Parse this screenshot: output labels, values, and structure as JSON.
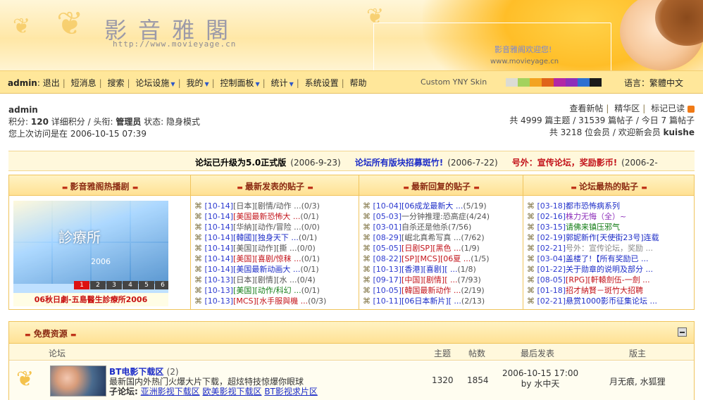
{
  "header": {
    "site_title": "影音雅閣",
    "site_url": "http://www.movieyage.cn",
    "welcome_text": "影音雅阁欢迎您!",
    "site_url_small": "www.movieyage.cn"
  },
  "nav": {
    "user": "admin",
    "items": [
      {
        "label": "退出",
        "dropdown": false
      },
      {
        "label": "短消息",
        "dropdown": false
      },
      {
        "label": "搜索",
        "dropdown": false
      },
      {
        "label": "论坛设施",
        "dropdown": true
      },
      {
        "label": "我的",
        "dropdown": true
      },
      {
        "label": "控制面板",
        "dropdown": true
      },
      {
        "label": "统计",
        "dropdown": true
      },
      {
        "label": "系统设置",
        "dropdown": false
      },
      {
        "label": "帮助",
        "dropdown": false
      }
    ],
    "skin_label": "Custom YNY Skin",
    "skin_colors": [
      "#dcdcd4",
      "#a4d25d",
      "#f3a321",
      "#e0641a",
      "#b327a6",
      "#8d2fba",
      "#2c70d1",
      "#1a1a1a"
    ],
    "language_label": "语言：繁體中文"
  },
  "user_info": {
    "username": "admin",
    "line1_label": "积分:",
    "points": "120",
    "line1_rest": "详细积分 / 头衔:",
    "rank": "管理员",
    "status_label": "状态:",
    "status": "隐身模式",
    "last_visit": "您上次访问是在 2006-10-15 07:39"
  },
  "stats": {
    "links": [
      "查看新帖",
      "精华区",
      "标记已读"
    ],
    "line2": "共 4999 篇主题 / 31539 篇帖子 / 今日 7 篇帖子",
    "line3_prefix": "共 3218 位会员 / 欢迎新会员",
    "newest_member": "kuishe"
  },
  "announcements": [
    {
      "title": "论坛已升级为5.0正式版",
      "date": "(2006-9-23)",
      "color": "#000000"
    },
    {
      "title": "论坛所有版块招募斑竹!",
      "date": "(2006-7-22)",
      "color": "#1c2cc7"
    },
    {
      "title": "号外：宣传论坛，奖励影币!",
      "date": "(2006-2-",
      "color": "#c3141b"
    }
  ],
  "board": {
    "columns": [
      "影音雅阁热播剧",
      "最新发表的贴子",
      "最新回复的贴子",
      "论坛最热的贴子"
    ],
    "promo": {
      "title": "診療所",
      "year": "2006",
      "nums": [
        "1",
        "2",
        "3",
        "4",
        "5",
        "6"
      ],
      "caption": "06秋日劇-五島醫生診療所2006"
    },
    "latest_posts": [
      {
        "date": "[10-14]",
        "title": "[日本][剧情/动作 ...",
        "count": "(0/3)"
      },
      {
        "date": "[10-14]",
        "title": "[美国最新恐怖大 ...",
        "count": "(0/1)"
      },
      {
        "date": "[10-14]",
        "title": "[华納][动作/冒险 ...",
        "count": "(0/0)"
      },
      {
        "date": "[10-14]",
        "title": "[韓國][独身天下 ...",
        "count": "(0/1)"
      },
      {
        "date": "[10-14]",
        "title": "[美国][动作][撕 ...",
        "count": "(0/0)"
      },
      {
        "date": "[10-14]",
        "title": "[美国][喜剧/惊秣 ...",
        "count": "(0/1)"
      },
      {
        "date": "[10-14]",
        "title": "[美国最新动画大 ...",
        "count": "(0/1)"
      },
      {
        "date": "[10-13]",
        "title": "[日本][剧情][水 ...",
        "count": "(0/4)"
      },
      {
        "date": "[10-13]",
        "title": "[美国][动作/科幻 ...",
        "count": "(0/1)"
      },
      {
        "date": "[10-13]",
        "title": "[MCS][水手服與機 ...",
        "count": "(0/3)"
      }
    ],
    "latest_posts_colors": [
      "#555555",
      "#c3141b",
      "#555555",
      "#1c2cc7",
      "#555555",
      "#c3141b",
      "#1c2cc7",
      "#555555",
      "#137d16",
      "#c3141b"
    ],
    "latest_replies": [
      {
        "date": "[10-04]",
        "title": "[06成龙最新大 ...",
        "count": "(5/19)"
      },
      {
        "date": "[05-03]",
        "title": "一分钟推理:恐高症",
        "count": "(4/24)"
      },
      {
        "date": "[03-01]",
        "title": "自杀还是他杀",
        "count": "(7/56)"
      },
      {
        "date": "[08-29]",
        "title": "[崛北真希写真 ...",
        "count": "(7/62)"
      },
      {
        "date": "[05-05]",
        "title": "[日剧SP][黑色 ...",
        "count": "(1/9)"
      },
      {
        "date": "[08-22]",
        "title": "[SP][MCS][06夏 ...",
        "count": "(1/5)"
      },
      {
        "date": "[10-13]",
        "title": "[香港][喜剧][ ...",
        "count": "(1/8)"
      },
      {
        "date": "[09-17]",
        "title": "[中国][剧情][ ...",
        "count": "(7/93)"
      },
      {
        "date": "[10-05]",
        "title": "[韓国最新动作 ...",
        "count": "(2/19)"
      },
      {
        "date": "[10-11]",
        "title": "[06日本新片][ ...",
        "count": "(2/13)"
      }
    ],
    "latest_replies_colors": [
      "#1c2cc7",
      "#555555",
      "#555555",
      "#555555",
      "#c3141b",
      "#c3141b",
      "#1c2cc7",
      "#c3141b",
      "#c3141b",
      "#1c2cc7"
    ],
    "hot_posts": [
      {
        "date": "[03-18]",
        "title": "都市恐怖病系列"
      },
      {
        "date": "[02-16]",
        "title": "株力无悔（全）~"
      },
      {
        "date": "[03-15]",
        "title": "请佛来镇压邪气"
      },
      {
        "date": "[02-19]",
        "title": "郭妮新作[天使街23号]连载"
      },
      {
        "date": "[02-21]",
        "title": "号外：宣传论坛，奖励 ..."
      },
      {
        "date": "[03-04]",
        "title": "盖楼了!【所有奖励已 ..."
      },
      {
        "date": "[01-22]",
        "title": "关于勋章的说明及部分 ..."
      },
      {
        "date": "[08-05]",
        "title": "[RPG][軒轅劍伍-一劍 ..."
      },
      {
        "date": "[01-18]",
        "title": "招才納賢－斑竹大招聘"
      },
      {
        "date": "[02-21]",
        "title": "悬赏1000影币征集论坛 ..."
      }
    ],
    "hot_posts_colors": [
      "#1c2cc7",
      "#8d2fba",
      "#137d16",
      "#1c2cc7",
      "#8a8a8a",
      "#1c2cc7",
      "#1c2cc7",
      "#c3141b",
      "#c3141b",
      "#1c2cc7"
    ]
  },
  "forum": {
    "category_title": "免费资源",
    "columns": {
      "forum": "论坛",
      "topics": "主题",
      "posts": "帖数",
      "last": "最后发表",
      "mods": "版主"
    },
    "row": {
      "name": "BT电影下载区",
      "name_count": "(2)",
      "description": "最新国内外热门火爆大片下载，超炫特技惊爆你眼球",
      "sub_label": "子论坛:",
      "subforums": [
        "亚洲影视下载区",
        "欧美影视下载区",
        "BT影视求片区"
      ],
      "topics": "1320",
      "posts": "1854",
      "last_time": "2006-10-15 17:00",
      "last_by": "by 水中天",
      "moderators": "月无痕, 水狐狸"
    }
  }
}
